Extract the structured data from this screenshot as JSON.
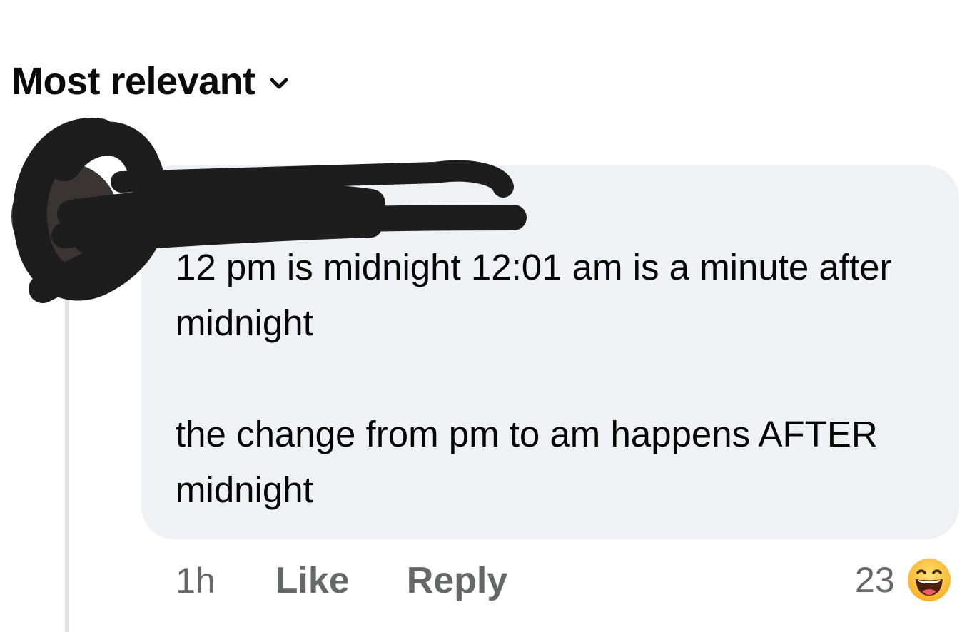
{
  "sort": {
    "label": "Most relevant",
    "icon": "chevron-down-icon"
  },
  "comment": {
    "author": "",
    "avatar_icon": "avatar",
    "paragraphs": [
      "12 pm is midnight 12:01 am is a minute after midnight",
      "the change from pm to am happens AFTER midnight"
    ],
    "timestamp": "1h",
    "like_label": "Like",
    "reply_label": "Reply",
    "reaction_count": "23",
    "reaction_icon": "haha-emoji-icon"
  },
  "colors": {
    "bubble_background": "#f0f1f5",
    "meta_text": "#65676b",
    "redaction": "#1d1d1d",
    "thread_line": "#dfe1e5"
  }
}
